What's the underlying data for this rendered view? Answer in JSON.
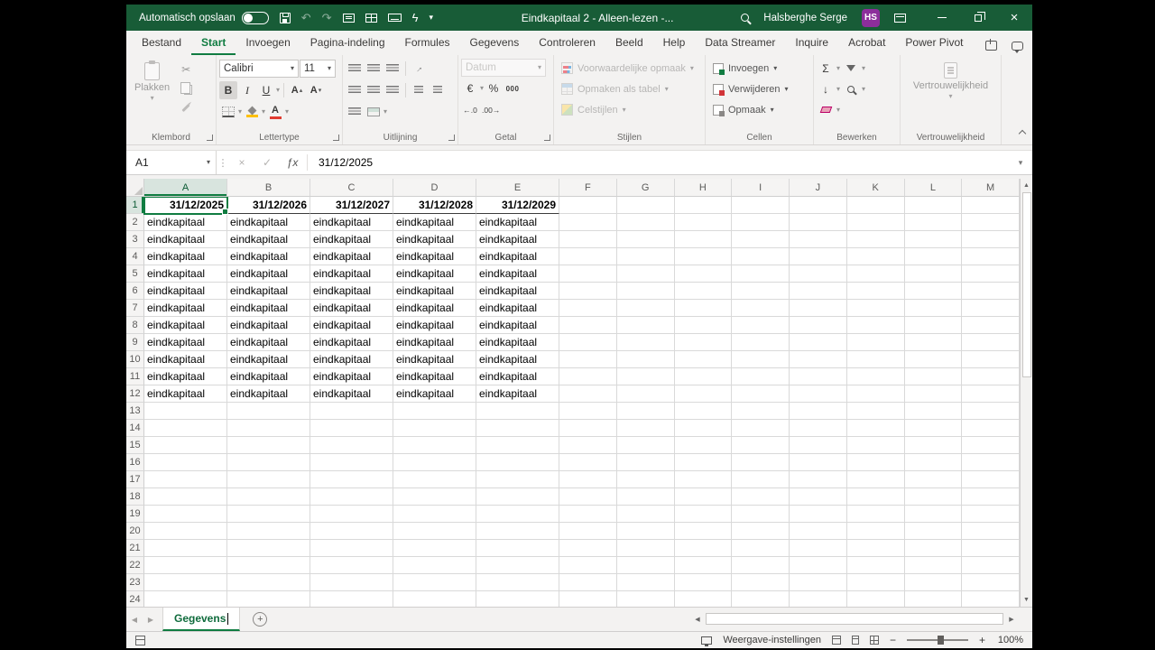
{
  "window": {
    "titlebar": {
      "autosave_label": "Automatisch opslaan",
      "title": "Eindkapitaal 2  -  Alleen-lezen  -...",
      "user_name": "Halsberghe Serge",
      "user_initials": "HS"
    },
    "ribbon": {
      "tabs": [
        "Bestand",
        "Start",
        "Invoegen",
        "Pagina-indeling",
        "Formules",
        "Gegevens",
        "Controleren",
        "Beeld",
        "Help",
        "Data Streamer",
        "Inquire",
        "Acrobat",
        "Power Pivot"
      ],
      "active_tab": "Start",
      "clipboard": {
        "label": "Klembord",
        "paste": "Plakken"
      },
      "font": {
        "label": "Lettertype",
        "name": "Calibri",
        "size": "11",
        "bold": "B",
        "italic": "I",
        "underline": "U",
        "grow": "A",
        "shrink": "A",
        "color_letter": "A"
      },
      "alignment": {
        "label": "Uitlijning"
      },
      "number": {
        "label": "Getal",
        "format": "Datum",
        "currency": "€",
        "percent": "%",
        "thousands": "000",
        "inc_decimal": "←.0",
        "dec_decimal": ".00→"
      },
      "styles": {
        "label": "Stijlen",
        "conditional": "Voorwaardelijke opmaak",
        "as_table": "Opmaken als tabel",
        "cell_styles": "Celstijlen"
      },
      "cells": {
        "label": "Cellen",
        "insert": "Invoegen",
        "delete": "Verwijderen",
        "format": "Opmaak"
      },
      "editing": {
        "label": "Bewerken",
        "autosum": "Σ"
      },
      "sensitivity": {
        "label": "Vertrouwelijkheid",
        "button": "Vertrouwelijkheid"
      }
    },
    "formula_bar": {
      "name_box": "A1",
      "fx": "ƒx",
      "value": "31/12/2025"
    },
    "grid": {
      "column_letters": [
        "A",
        "B",
        "C",
        "D",
        "E",
        "F",
        "G",
        "H",
        "I",
        "J",
        "K",
        "L",
        "M"
      ],
      "total_rows": 24,
      "selected_cell": "A1",
      "date_row": {
        "row": 1,
        "values": [
          "31/12/2025",
          "31/12/2026",
          "31/12/2027",
          "31/12/2028",
          "31/12/2029"
        ]
      },
      "body": {
        "rows_from": 2,
        "rows_to": 12,
        "columns": [
          "A",
          "B",
          "C",
          "D",
          "E"
        ],
        "value": "eindkapitaal"
      }
    },
    "sheet_bar": {
      "active_tab": "Gegevens"
    },
    "status_bar": {
      "view_settings": "Weergave-instellingen",
      "zoom": "100%"
    }
  }
}
